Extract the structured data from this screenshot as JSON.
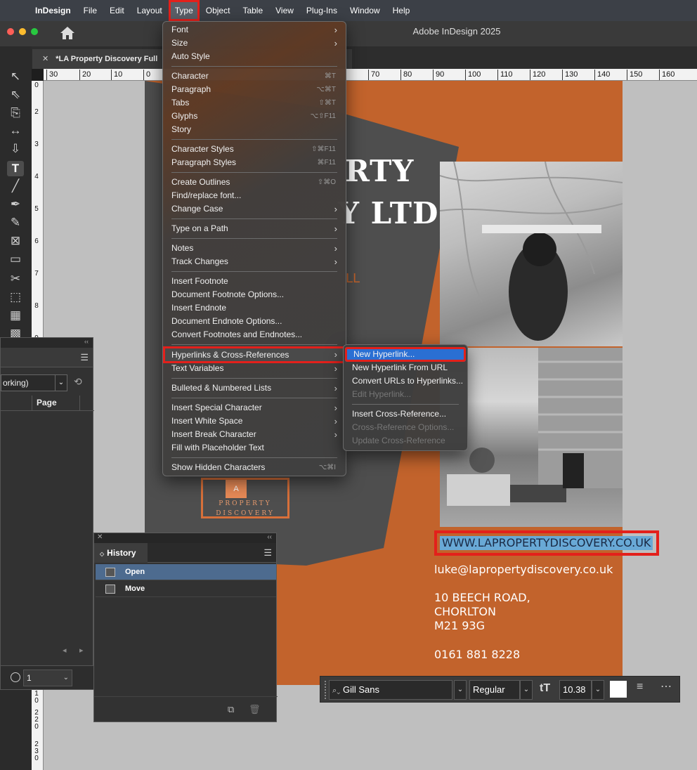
{
  "menubar": {
    "app_name": "InDesign",
    "items": [
      "File",
      "Edit",
      "Layout",
      "Type",
      "Object",
      "Table",
      "View",
      "Plug-Ins",
      "Window",
      "Help"
    ]
  },
  "window": {
    "title": "Adobe InDesign 2025",
    "tab_label": "*LA Property Discovery Full"
  },
  "ruler": {
    "horizontal": [
      "30",
      "20",
      "10",
      "0",
      "70",
      "80",
      "90",
      "100",
      "110",
      "120",
      "130",
      "140",
      "150",
      "160"
    ],
    "vertical": [
      "0",
      "2",
      "3",
      "4",
      "5",
      "6",
      "7",
      "8",
      "9",
      "1\n0",
      "2\n2\n0",
      "2\n3\n0"
    ]
  },
  "type_menu": {
    "items": [
      {
        "label": "Font",
        "submenu": true
      },
      {
        "label": "Size",
        "submenu": true
      },
      {
        "label": "Auto Style"
      },
      {
        "label": "Character",
        "shortcut": "⌘T"
      },
      {
        "label": "Paragraph",
        "shortcut": "⌥⌘T"
      },
      {
        "label": "Tabs",
        "shortcut": "⇧⌘T"
      },
      {
        "label": "Glyphs",
        "shortcut": "⌥⇧F11"
      },
      {
        "label": "Story"
      },
      {
        "label": "Character Styles",
        "shortcut": "⇧⌘F11"
      },
      {
        "label": "Paragraph Styles",
        "shortcut": "⌘F11"
      },
      {
        "label": "Create Outlines",
        "shortcut": "⇧⌘O"
      },
      {
        "label": "Find/replace font..."
      },
      {
        "label": "Change Case",
        "submenu": true
      },
      {
        "label": "Type on a Path",
        "submenu": true
      },
      {
        "label": "Notes",
        "submenu": true
      },
      {
        "label": "Track Changes",
        "submenu": true
      },
      {
        "label": "Insert Footnote"
      },
      {
        "label": "Document Footnote Options..."
      },
      {
        "label": "Insert Endnote"
      },
      {
        "label": "Document Endnote Options..."
      },
      {
        "label": "Convert Footnotes and Endnotes..."
      },
      {
        "label": "Hyperlinks & Cross-References",
        "submenu": true
      },
      {
        "label": "Text Variables",
        "submenu": true
      },
      {
        "label": "Bulleted & Numbered Lists",
        "submenu": true
      },
      {
        "label": "Insert Special Character",
        "submenu": true
      },
      {
        "label": "Insert White Space",
        "submenu": true
      },
      {
        "label": "Insert Break Character",
        "submenu": true
      },
      {
        "label": "Fill with Placeholder Text"
      },
      {
        "label": "Show Hidden Characters",
        "shortcut": "⌥⌘I"
      }
    ]
  },
  "hyperlinks_submenu": {
    "items": [
      {
        "label": "New Hyperlink...",
        "enabled": true
      },
      {
        "label": "New Hyperlink From URL",
        "enabled": true
      },
      {
        "label": "Convert URLs to Hyperlinks...",
        "enabled": true
      },
      {
        "label": "Edit Hyperlink...",
        "enabled": false
      },
      {
        "label": "Insert Cross-Reference...",
        "enabled": true
      },
      {
        "label": "Cross-Reference Options...",
        "enabled": false
      },
      {
        "label": "Update Cross-Reference",
        "enabled": false
      }
    ]
  },
  "flyer": {
    "headline_1": "RTY",
    "headline_2": "Y LTD",
    "headline_fragment": "LL",
    "website": "WWW.LAPROPERTYDISCOVERY.CO.UK",
    "email": "luke@lapropertydiscovery.co.uk",
    "address_1": "10 BEECH ROAD,",
    "address_2": "CHORLTON",
    "address_3": "M21 93G",
    "phone": "0161 881 8228",
    "logo_mark": "A",
    "logo_line_1": "PROPERTY",
    "logo_line_2": "DISCOVERY"
  },
  "left_panel": {
    "dropdown_value": "orking)",
    "column_page": "Page",
    "page_value": "1"
  },
  "history_panel": {
    "tab_label": "History",
    "items": [
      "Open",
      "Move"
    ]
  },
  "control_bar": {
    "font_family": "Gill Sans",
    "font_style": "Regular",
    "font_size": "10.38"
  },
  "colors": {
    "flyer_orange": "#c2632c",
    "highlight_red": "#e3201b",
    "selection_blue": "#2a6fd3",
    "url_highlight": "#69a9d6"
  }
}
